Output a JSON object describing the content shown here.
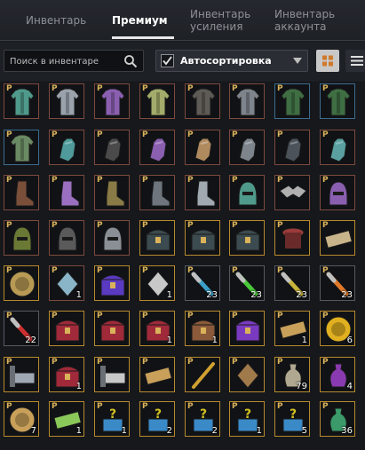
{
  "tabs": [
    {
      "label": "Инвентарь",
      "active": false
    },
    {
      "label": "Премиум",
      "active": true
    },
    {
      "label": "Инвентарь усиления",
      "active": false
    },
    {
      "label": "Инвентарь аккаунта",
      "active": false
    }
  ],
  "search": {
    "placeholder": "Поиск в инвентаре"
  },
  "sort": {
    "label": "Автосортировка",
    "checked": true
  },
  "colors": {
    "accent_gold": "#d9b25a",
    "border_brown": "#7d4a3e",
    "border_blue": "#3d6c8f",
    "border_gold": "#b88a2e"
  },
  "items": [
    {
      "icon": "teal-armor-icon",
      "p": "P",
      "count": "",
      "color": "#4f9a8a",
      "frame": "brown"
    },
    {
      "icon": "silver-armor-icon",
      "p": "P",
      "count": "",
      "color": "#9aa2ac",
      "frame": "brown"
    },
    {
      "icon": "purple-armor-icon",
      "p": "P",
      "count": "",
      "color": "#8a5fb0",
      "frame": "brown"
    },
    {
      "icon": "green-armor-icon",
      "p": "P",
      "count": "",
      "color": "#a3ac6a",
      "frame": "brown"
    },
    {
      "icon": "dark-armor-icon",
      "p": "P",
      "count": "",
      "color": "#5e5a55",
      "frame": "brown"
    },
    {
      "icon": "steel-armor-icon",
      "p": "P",
      "count": "",
      "color": "#7d848c",
      "frame": "brown"
    },
    {
      "icon": "green-robe-icon",
      "p": "P",
      "count": "",
      "color": "#3f6e43",
      "frame": "blue"
    },
    {
      "icon": "green-robe-icon",
      "p": "P",
      "count": "",
      "color": "#3f6e43",
      "frame": "blue"
    },
    {
      "icon": "green-armor-icon",
      "p": "P",
      "count": "",
      "color": "#6a8a63",
      "frame": "blue"
    },
    {
      "icon": "teal-gloves-icon",
      "p": "P",
      "count": "",
      "color": "#4f9a9a",
      "frame": "brown"
    },
    {
      "icon": "black-gloves-icon",
      "p": "P",
      "count": "",
      "color": "#4a4a4a",
      "frame": "brown"
    },
    {
      "icon": "purple-gloves-icon",
      "p": "P",
      "count": "",
      "color": "#8a5fb0",
      "frame": "brown"
    },
    {
      "icon": "leather-gloves-icon",
      "p": "P",
      "count": "",
      "color": "#b08a5f",
      "frame": "brown"
    },
    {
      "icon": "steel-gloves-icon",
      "p": "P",
      "count": "",
      "color": "#7d848c",
      "frame": "brown"
    },
    {
      "icon": "dark-gloves-icon",
      "p": "P",
      "count": "",
      "color": "#4b5259",
      "frame": "brown"
    },
    {
      "icon": "teal-gloves-icon",
      "p": "P",
      "count": "",
      "color": "#5aa0a0",
      "frame": "brown"
    },
    {
      "icon": "leather-boots-icon",
      "p": "P",
      "count": "",
      "color": "#7a4f3a",
      "frame": "brown"
    },
    {
      "icon": "purple-boots-icon",
      "p": "P",
      "count": "",
      "color": "#9b6fc0",
      "frame": "brown"
    },
    {
      "icon": "brown-boots-icon",
      "p": "P",
      "count": "",
      "color": "#8a7a45",
      "frame": "brown"
    },
    {
      "icon": "steel-boots-icon",
      "p": "P",
      "count": "",
      "color": "#6e757d",
      "frame": "brown"
    },
    {
      "icon": "silver-boots-icon",
      "p": "P",
      "count": "",
      "color": "#a0a8b0",
      "frame": "brown"
    },
    {
      "icon": "teal-helmet-icon",
      "p": "P",
      "count": "",
      "color": "#4f9a8a",
      "frame": "brown"
    },
    {
      "icon": "mask-icon",
      "p": "P",
      "count": "",
      "color": "#b0b0b0",
      "frame": "brown"
    },
    {
      "icon": "purple-helmet-icon",
      "p": "P",
      "count": "",
      "color": "#8a5fb0",
      "frame": "brown"
    },
    {
      "icon": "green-hood-icon",
      "p": "P",
      "count": "",
      "color": "#6a7a35",
      "frame": "brown"
    },
    {
      "icon": "dark-helmet-icon",
      "p": "P",
      "count": "",
      "color": "#5a5a5a",
      "frame": "brown"
    },
    {
      "icon": "knight-helmet-icon",
      "p": "P",
      "count": "",
      "color": "#8a8f95",
      "frame": "brown"
    },
    {
      "icon": "black-chest-icon",
      "p": "P",
      "count": "",
      "color": "#3c4b4f",
      "frame": "gold"
    },
    {
      "icon": "black-chest-icon",
      "p": "P",
      "count": "",
      "color": "#3c4b4f",
      "frame": "gold"
    },
    {
      "icon": "black-chest-icon",
      "p": "P",
      "count": "",
      "color": "#3c4b4f",
      "frame": "gold"
    },
    {
      "icon": "red-drum-icon",
      "p": "P",
      "count": "",
      "color": "#9a3a3a",
      "frame": "gold"
    },
    {
      "icon": "scroll-orb-icon",
      "p": "P",
      "count": "",
      "color": "#c8b48a",
      "frame": "gold"
    },
    {
      "icon": "globe-icon",
      "p": "P",
      "count": "",
      "color": "#b89a55",
      "frame": "gold"
    },
    {
      "icon": "crystal-icon",
      "p": "P",
      "count": "1",
      "color": "#8ab4c8",
      "frame": "brown"
    },
    {
      "icon": "crate-icon",
      "p": "P",
      "count": "",
      "color": "#5a3ac0",
      "frame": "gold"
    },
    {
      "icon": "tree-icon",
      "p": "P",
      "count": "1",
      "color": "#c8c8c8",
      "frame": "gold"
    },
    {
      "icon": "blue-potion-icon",
      "p": "P",
      "count": "23",
      "color": "#3aa0c8",
      "frame": "grey"
    },
    {
      "icon": "green-potion-icon",
      "p": "P",
      "count": "23",
      "color": "#4ac83a",
      "frame": "grey"
    },
    {
      "icon": "yellow-potion-icon",
      "p": "P",
      "count": "23",
      "color": "#c8b43a",
      "frame": "grey"
    },
    {
      "icon": "orange-potion-icon",
      "p": "P",
      "count": "23",
      "color": "#e07a2a",
      "frame": "grey"
    },
    {
      "icon": "red-potion-icon",
      "p": "P",
      "count": "22",
      "color": "#d03030",
      "frame": "grey"
    },
    {
      "icon": "red-chest-icon",
      "p": "P",
      "count": "",
      "color": "#a02a3a",
      "frame": "gold"
    },
    {
      "icon": "red-chest-icon",
      "p": "P",
      "count": "",
      "color": "#a02a3a",
      "frame": "gold"
    },
    {
      "icon": "red-chest-icon",
      "p": "P",
      "count": "1",
      "color": "#a02a3a",
      "frame": "gold"
    },
    {
      "icon": "wood-chest-icon",
      "p": "P",
      "count": "1",
      "color": "#8a5a3a",
      "frame": "gold"
    },
    {
      "icon": "purple-chest-icon",
      "p": "P",
      "count": "",
      "color": "#7a3ac0",
      "frame": "gold"
    },
    {
      "icon": "ticket-icon",
      "p": "P",
      "count": "1",
      "color": "#c8a05a",
      "frame": "gold"
    },
    {
      "icon": "butterfly-icon",
      "p": "P",
      "count": "6",
      "color": "#e0b020",
      "frame": "gold"
    },
    {
      "icon": "bed-icon",
      "p": "P",
      "count": "",
      "color": "#a0a8b4",
      "frame": "gold"
    },
    {
      "icon": "red-chest-icon",
      "p": "P",
      "count": "1",
      "color": "#a02a3a",
      "frame": "gold"
    },
    {
      "icon": "white-bed-icon",
      "p": "P",
      "count": "",
      "color": "#c8c8c8",
      "frame": "gold"
    },
    {
      "icon": "ticket-icon",
      "p": "P",
      "count": "",
      "color": "#c8a05a",
      "frame": "gold"
    },
    {
      "icon": "golden-sword-icon",
      "p": "P",
      "count": "",
      "color": "#d0a030",
      "frame": "gold"
    },
    {
      "icon": "trophy-icon",
      "p": "P",
      "count": "",
      "color": "#a07a4a",
      "frame": "gold"
    },
    {
      "icon": "stone-vase-icon",
      "p": "P",
      "count": "79",
      "color": "#b0a890",
      "frame": "gold"
    },
    {
      "icon": "purple-vase-icon",
      "p": "P",
      "count": "4",
      "color": "#8a3ab0",
      "frame": "gold"
    },
    {
      "icon": "medal-icon",
      "p": "P",
      "count": "7",
      "color": "#c8a05a",
      "frame": "gold"
    },
    {
      "icon": "green-ticket-icon",
      "p": "P",
      "count": "1",
      "color": "#8ac85a",
      "frame": "gold"
    },
    {
      "icon": "mystery-box-icon",
      "p": "P",
      "count": "1",
      "color": "#d0c020",
      "frame": "gold"
    },
    {
      "icon": "mystery-box-icon",
      "p": "P",
      "count": "2",
      "color": "#d0c020",
      "frame": "gold"
    },
    {
      "icon": "mystery-box-icon",
      "p": "P",
      "count": "2",
      "color": "#d0c020",
      "frame": "gold"
    },
    {
      "icon": "mystery-box-icon",
      "p": "P",
      "count": "1",
      "color": "#d0c020",
      "frame": "gold"
    },
    {
      "icon": "mystery-box-icon",
      "p": "P",
      "count": "5",
      "color": "#d0c020",
      "frame": "gold"
    },
    {
      "icon": "green-vase-icon",
      "p": "P",
      "count": "36",
      "color": "#3a9a6a",
      "frame": "gold"
    }
  ]
}
